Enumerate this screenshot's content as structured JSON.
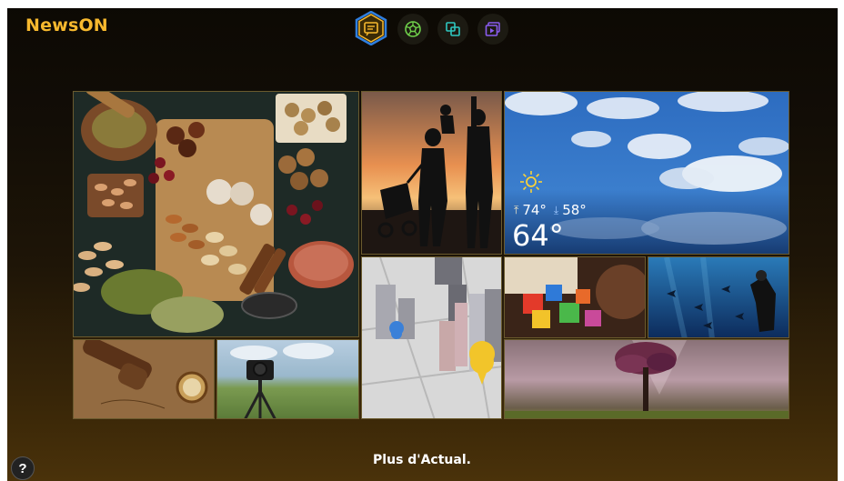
{
  "app": {
    "title": "NewsON"
  },
  "tabs": [
    {
      "id": "news",
      "icon": "news-icon",
      "active": true,
      "color": "#f7b92e"
    },
    {
      "id": "sports",
      "icon": "soccer-ball-icon",
      "active": false,
      "color": "#6fd04a"
    },
    {
      "id": "apps",
      "icon": "overlapping-squares-icon",
      "active": false,
      "color": "#2ec7c0"
    },
    {
      "id": "videos",
      "icon": "video-stack-icon",
      "active": false,
      "color": "#8a5cf0"
    }
  ],
  "weather": {
    "high": "74°",
    "low": "58°",
    "current": "64°",
    "icon": "sun-icon"
  },
  "footer": {
    "more_label": "Plus d'Actual.",
    "help_label": "?"
  }
}
